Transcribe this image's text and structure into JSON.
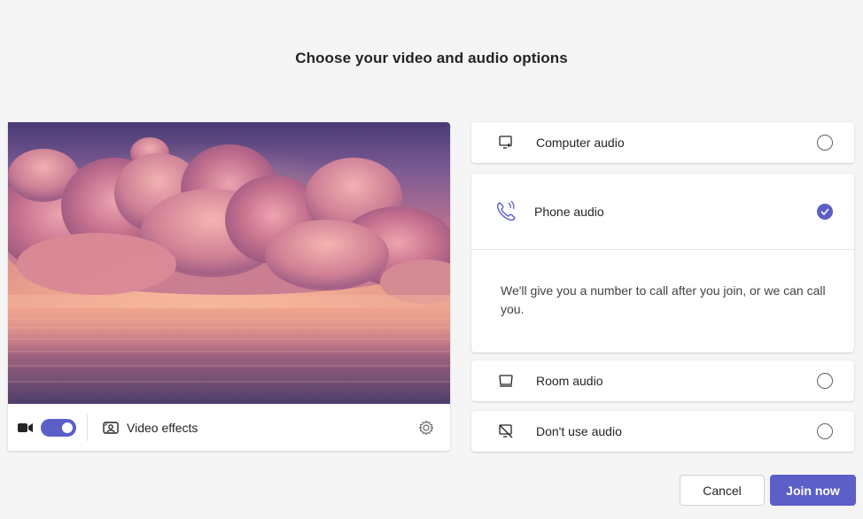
{
  "page": {
    "title": "Choose your video and audio options"
  },
  "video": {
    "camera_icon": "video-camera-icon",
    "camera_on": true,
    "effects_label": "Video effects",
    "effects_icon": "background-effects-icon",
    "settings_icon": "gear-icon",
    "preview_description": "pink clouds over water sunset background"
  },
  "audio_options": {
    "computer": {
      "label": "Computer audio",
      "icon": "computer-speaker-icon",
      "selected": false
    },
    "phone": {
      "label": "Phone audio",
      "icon": "phone-call-icon",
      "selected": true,
      "description": "We'll give you a number to call after you join, or we can call you."
    },
    "room": {
      "label": "Room audio",
      "icon": "room-device-icon",
      "selected": false
    },
    "none": {
      "label": "Don't use audio",
      "icon": "no-audio-icon",
      "selected": false
    }
  },
  "actions": {
    "cancel_label": "Cancel",
    "join_label": "Join now"
  },
  "colors": {
    "accent": "#5b5fc7",
    "background": "#f5f5f5",
    "card": "#ffffff"
  }
}
